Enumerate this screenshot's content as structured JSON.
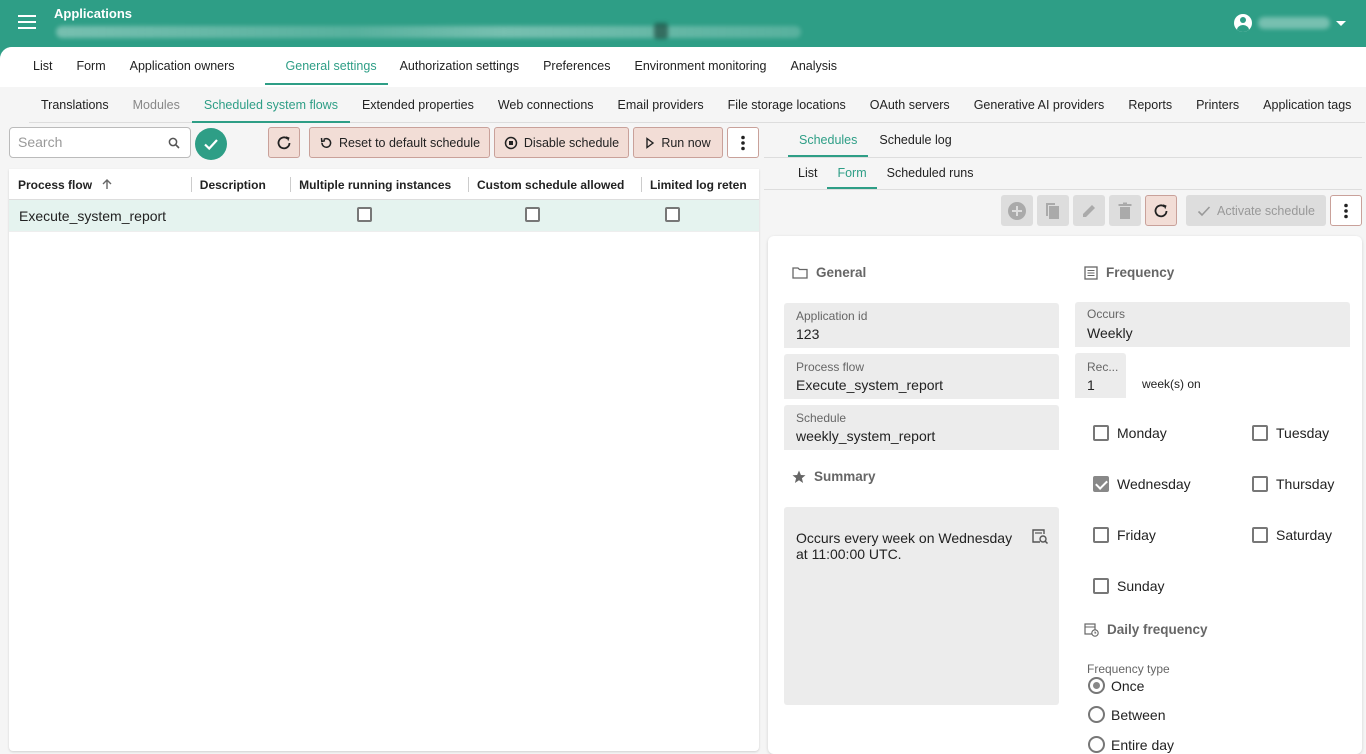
{
  "header": {
    "title": "Applications"
  },
  "nav_tabs": [
    "List",
    "Form",
    "Application owners",
    "General settings",
    "Authorization settings",
    "Preferences",
    "Environment monitoring",
    "Analysis"
  ],
  "sub_tabs": [
    "Translations",
    "Modules",
    "Scheduled system flows",
    "Extended properties",
    "Web connections",
    "Email providers",
    "File storage locations",
    "OAuth servers",
    "Generative AI providers",
    "Reports",
    "Printers",
    "Application tags"
  ],
  "toolbar": {
    "search_placeholder": "Search",
    "reset_label": "Reset to default schedule",
    "disable_label": "Disable schedule",
    "run_label": "Run now"
  },
  "grid": {
    "columns": [
      "Process flow",
      "Description",
      "Multiple running instances",
      "Custom schedule allowed",
      "Limited log reten"
    ],
    "rows": [
      {
        "process_flow": "Execute_system_report",
        "description": "",
        "multiple_running": false,
        "custom_schedule": false,
        "limited_log": false
      }
    ]
  },
  "right_tabs": [
    "Schedules",
    "Schedule log"
  ],
  "right_subtabs": [
    "List",
    "Form",
    "Scheduled runs"
  ],
  "right_toolbar": {
    "activate_label": "Activate schedule"
  },
  "form": {
    "general_title": "General",
    "application_id_label": "Application id",
    "application_id": "123",
    "process_flow_label": "Process flow",
    "process_flow": "Execute_system_report",
    "schedule_label": "Schedule",
    "schedule": "weekly_system_report",
    "summary_title": "Summary",
    "summary_text": "Occurs every week on Wednesday at 11:00:00 UTC.",
    "frequency_title": "Frequency",
    "occurs_label": "Occurs",
    "occurs": "Weekly",
    "recurs_label": "Rec...",
    "recurs": "1",
    "recurs_suffix": "week(s) on",
    "days": {
      "monday": {
        "label": "Monday",
        "checked": false
      },
      "tuesday": {
        "label": "Tuesday",
        "checked": false
      },
      "wednesday": {
        "label": "Wednesday",
        "checked": true
      },
      "thursday": {
        "label": "Thursday",
        "checked": false
      },
      "friday": {
        "label": "Friday",
        "checked": false
      },
      "saturday": {
        "label": "Saturday",
        "checked": false
      },
      "sunday": {
        "label": "Sunday",
        "checked": false
      }
    },
    "daily_title": "Daily frequency",
    "frequency_type_label": "Frequency type",
    "frequency_options": [
      "Once",
      "Between",
      "Entire day"
    ],
    "frequency_selected": "Once"
  },
  "colors": {
    "brand": "#2e9e86",
    "accent_button": "#f2ddd6",
    "selected_row": "#e5f3ef"
  }
}
